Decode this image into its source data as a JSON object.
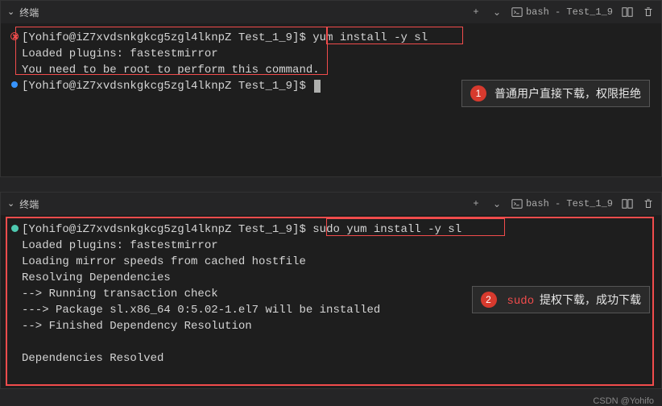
{
  "panel1": {
    "title": "终端",
    "shell": "bash - Test_1_9",
    "prompt1_user": "[Yohifo@iZ7xvdsnkgkcg5zgl4lknpZ Test_1_9]$ ",
    "cmd1": "yum install -y sl",
    "out1": "Loaded plugins: fastestmirror",
    "out2": "You need to be root to perform this command.",
    "prompt2_user": "[Yohifo@iZ7xvdsnkgkcg5zgl4lknpZ Test_1_9]$ ",
    "callout_num": "1",
    "callout_text": "普通用户直接下载，权限拒绝"
  },
  "panel2": {
    "title": "终端",
    "shell": "bash - Test_1_9",
    "prompt1_user": "[Yohifo@iZ7xvdsnkgkcg5zgl4lknpZ Test_1_9]$ ",
    "cmd1": "sudo yum install -y sl",
    "out1": "Loaded plugins: fastestmirror",
    "out2": "Loading mirror speeds from cached hostfile",
    "out3": "Resolving Dependencies",
    "out4": "--> Running transaction check",
    "out5": "---> Package sl.x86_64 0:5.02-1.el7 will be installed",
    "out6": "--> Finished Dependency Resolution",
    "out7": "Dependencies Resolved",
    "callout_num": "2",
    "callout_pre": "",
    "callout_sudo": "sudo",
    "callout_post": "提权下载，成功下载"
  },
  "icons": {
    "plus": "+",
    "chevdown": "⌄",
    "split": "▯▯",
    "trash": "🗑"
  },
  "watermark": "CSDN @Yohifo"
}
